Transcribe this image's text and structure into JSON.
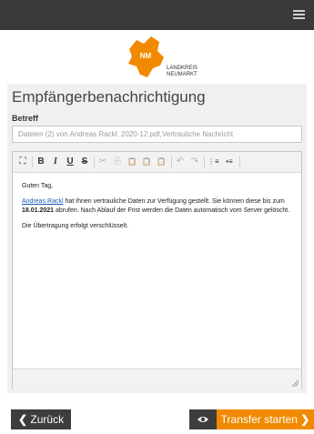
{
  "header": {
    "menu_icon": "hamburger-menu-icon"
  },
  "logo": {
    "badge": "NM",
    "line1": "LANDKREIS",
    "line2": "NEUMARKT",
    "color": "#f18a00"
  },
  "page": {
    "title": "Empfängerbenachrichtigung"
  },
  "subject": {
    "label": "Betreff",
    "value": "Dateien (2) von Andreas Rackl: 2020-12.pdf,Vertrauliche Nachricht"
  },
  "toolbar": {
    "maximize": "⛶",
    "bold": "B",
    "italic": "I",
    "underline": "U",
    "strikethrough": "S",
    "cut": "✂",
    "copy": "⎘",
    "paste": "📋",
    "paste_text": "📋",
    "paste_word": "📋",
    "undo": "↶",
    "redo": "↷",
    "numbered_list": "⋮≡",
    "bulleted_list": "•≡"
  },
  "message": {
    "greeting": "Guten Tag,",
    "sender_link": "Andreas Rackl",
    "text1": " hat Ihnen vertrauliche Daten zur Verfügung gestellt. Sie können diese bis zum ",
    "date": "18.01.2021",
    "text2": " abrufen. Nach Ablauf der Frist werden die Daten automatisch vom Server gelöscht.",
    "encryption_note": "Die Übertragung erfolgt verschlüsselt."
  },
  "footer": {
    "back_label": "Zurück",
    "back_icon": "chevron-left-icon",
    "preview_icon": "eye-icon",
    "transfer_label": "Transfer starten",
    "transfer_icon": "chevron-right-icon",
    "accent_color": "#f18a00",
    "dark_color": "#3d3d3d"
  }
}
